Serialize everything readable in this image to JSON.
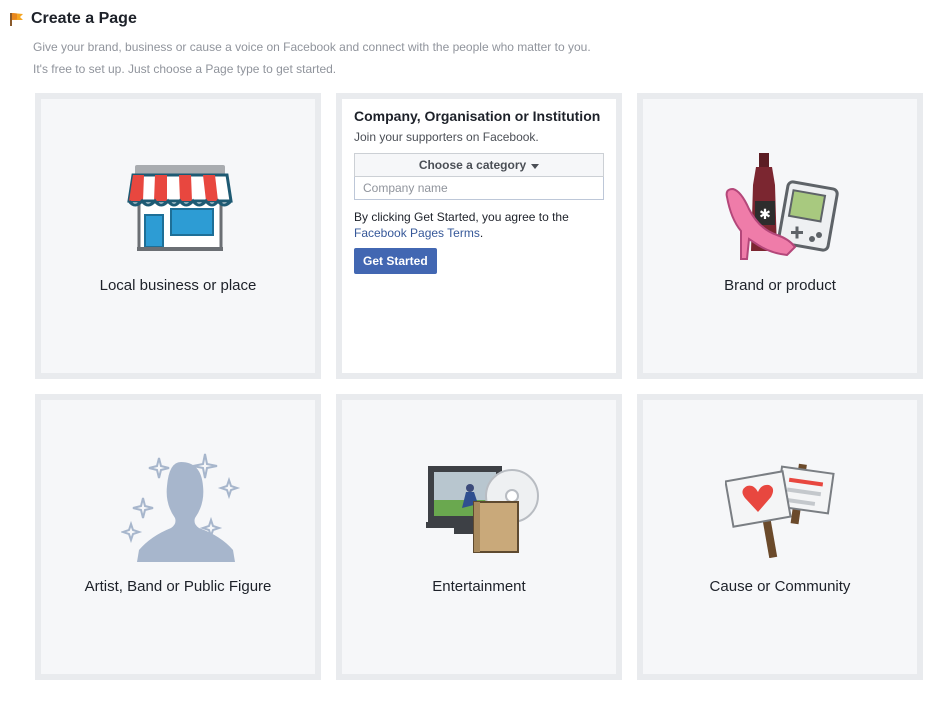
{
  "header": {
    "title": "Create a Page",
    "intro_line1": "Give your brand, business or cause a voice on Facebook and connect with the people who matter to you.",
    "intro_line2": "It's free to set up. Just choose a Page type to get started."
  },
  "cards": {
    "local": {
      "label": "Local business or place",
      "icon": "storefront-icon"
    },
    "company": {
      "title": "Company, Organisation or Institution",
      "subtitle": "Join your supporters on Facebook.",
      "category_label": "Choose a category",
      "name_placeholder": "Company name",
      "name_value": "",
      "terms_text": "By clicking Get Started, you agree to the",
      "terms_link": "Facebook Pages Terms",
      "terms_end": ".",
      "button_label": "Get Started"
    },
    "brand": {
      "label": "Brand or product",
      "icon": "shoe-bottle-gameboy-icon"
    },
    "artist": {
      "label": "Artist, Band or Public Figure",
      "icon": "silhouette-sparkles-icon"
    },
    "entertainment": {
      "label": "Entertainment",
      "icon": "tv-book-disc-icon"
    },
    "cause": {
      "label": "Cause or Community",
      "icon": "protest-signs-icon"
    }
  },
  "colors": {
    "accent": "#4267b2",
    "link": "#365899",
    "card_bg": "#f6f7f9",
    "card_border": "#e9ebee"
  }
}
